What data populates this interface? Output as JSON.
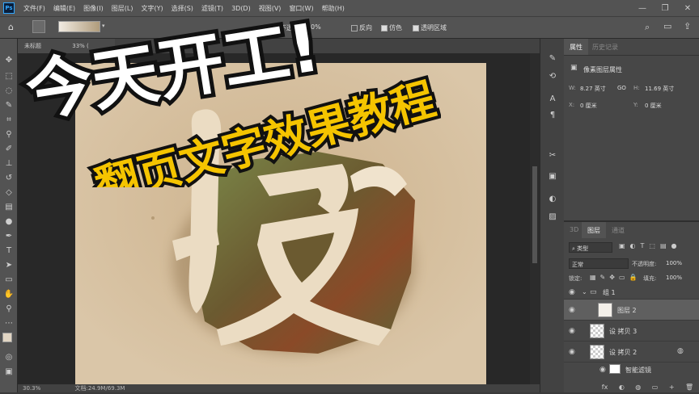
{
  "menubar": {
    "logo": "Ps",
    "items": [
      "文件(F)",
      "编辑(E)",
      "图像(I)",
      "图层(L)",
      "文字(Y)",
      "选择(S)",
      "滤镜(T)",
      "3D(D)",
      "视图(V)",
      "窗口(W)",
      "帮助(H)"
    ],
    "window_controls": [
      "—",
      "❐",
      "✕"
    ]
  },
  "options": {
    "opacity_label": "不透",
    "opacity_value": "0%",
    "reverse_label": "反向",
    "dither_label": "仿色",
    "transparency_label": "透明区域"
  },
  "document": {
    "tab_label": "未标题",
    "zoom_frag": "33% (",
    "status_zoom": "30.3%",
    "status_doc": "文档:24.9M/69.3M"
  },
  "overlay": {
    "title_main": "今天开工!",
    "title_sub": "翻页文字效果教程",
    "big_char": "设"
  },
  "properties": {
    "tab_properties": "属性",
    "tab_history": "历史记录",
    "section_title": "像素图层属性",
    "w_label": "W:",
    "w_value": "8.27 英寸",
    "link_icon": "GO",
    "h_label": "H:",
    "h_value": "11.69 英寸",
    "x_label": "X:",
    "x_value": "0 厘米",
    "y_label": "Y:",
    "y_value": "0 厘米"
  },
  "layers_panel": {
    "tab_3d": "3D",
    "tab_layers": "图层",
    "tab_channels": "通道",
    "filter_kind": "类型",
    "blend_mode": "正常",
    "opacity_label": "不透明度:",
    "opacity_value": "100%",
    "lock_label": "锁定:",
    "fill_label": "填充:",
    "fill_value": "100%",
    "layers": [
      {
        "name": "组 1",
        "type": "group"
      },
      {
        "name": "图层 2",
        "type": "pixel",
        "selected": true
      },
      {
        "name": "设 拷贝 3",
        "type": "pixel"
      },
      {
        "name": "设 拷贝 2",
        "type": "smart"
      },
      {
        "name": "智能滤镜",
        "type": "filter"
      }
    ],
    "footer_icons": [
      "fx",
      "◐",
      "◍",
      "▭",
      "+",
      "🗑"
    ]
  },
  "colors": {
    "canvas_bg": "#d9c3a4",
    "accent_yellow": "#f5c400",
    "title_stroke": "#111111",
    "letter_fill": "#ebdcc3",
    "texture_dark": "#6b5a30",
    "texture_green": "#7b8a4a"
  }
}
